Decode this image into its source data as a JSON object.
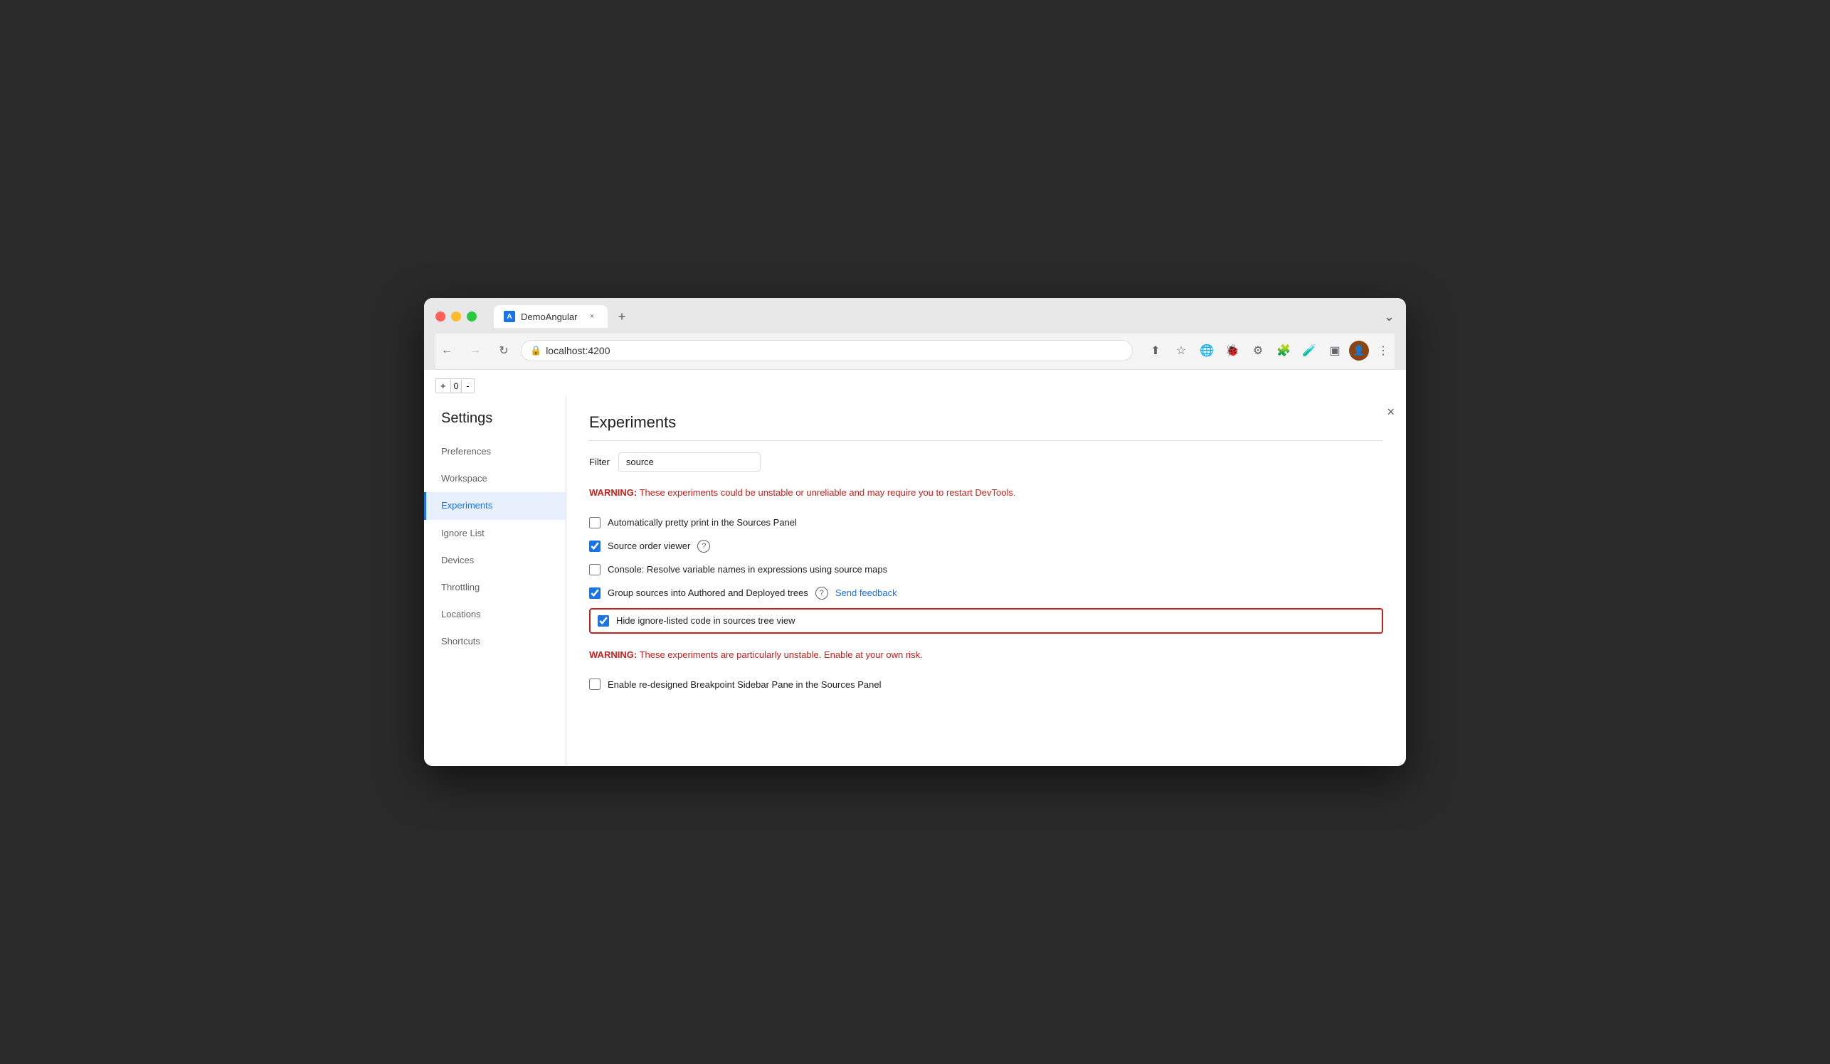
{
  "browser": {
    "tab_title": "DemoAngular",
    "tab_favicon": "A",
    "url": "localhost:4200",
    "new_tab_icon": "+",
    "window_controls": "⌄"
  },
  "nav": {
    "back_label": "←",
    "forward_label": "→",
    "refresh_label": "↻",
    "lock_icon": "🔒"
  },
  "devtools_counter": {
    "plus": "+",
    "value": "0",
    "minus": "-"
  },
  "settings": {
    "title": "Settings",
    "close_label": "×",
    "sidebar_items": [
      {
        "id": "preferences",
        "label": "Preferences",
        "active": false
      },
      {
        "id": "workspace",
        "label": "Workspace",
        "active": false
      },
      {
        "id": "experiments",
        "label": "Experiments",
        "active": true
      },
      {
        "id": "ignore-list",
        "label": "Ignore List",
        "active": false
      },
      {
        "id": "devices",
        "label": "Devices",
        "active": false
      },
      {
        "id": "throttling",
        "label": "Throttling",
        "active": false
      },
      {
        "id": "locations",
        "label": "Locations",
        "active": false
      },
      {
        "id": "shortcuts",
        "label": "Shortcuts",
        "active": false
      }
    ]
  },
  "experiments": {
    "page_title": "Experiments",
    "filter_label": "Filter",
    "filter_value": "source",
    "filter_placeholder": "Filter",
    "warning_1_prefix": "WARNING:",
    "warning_1_text": " These experiments could be unstable or unreliable and may require you to restart DevTools.",
    "items": [
      {
        "id": "pretty-print",
        "label": "Automatically pretty print in the Sources Panel",
        "checked": false,
        "highlighted": false,
        "has_help": false,
        "has_feedback": false
      },
      {
        "id": "source-order",
        "label": "Source order viewer",
        "checked": true,
        "highlighted": false,
        "has_help": true,
        "has_feedback": false
      },
      {
        "id": "console-resolve",
        "label": "Console: Resolve variable names in expressions using source maps",
        "checked": false,
        "highlighted": false,
        "has_help": false,
        "has_feedback": false
      },
      {
        "id": "group-sources",
        "label": "Group sources into Authored and Deployed trees",
        "checked": true,
        "highlighted": false,
        "has_help": true,
        "has_feedback": true,
        "feedback_label": "Send feedback"
      },
      {
        "id": "hide-ignore",
        "label": "Hide ignore-listed code in sources tree view",
        "checked": true,
        "highlighted": true,
        "has_help": false,
        "has_feedback": false
      }
    ],
    "warning_2_prefix": "WARNING:",
    "warning_2_text": " These experiments are particularly unstable. Enable at your own risk.",
    "unstable_items": [
      {
        "id": "breakpoint-sidebar",
        "label": "Enable re-designed Breakpoint Sidebar Pane in the Sources Panel",
        "checked": false,
        "highlighted": false
      }
    ]
  }
}
